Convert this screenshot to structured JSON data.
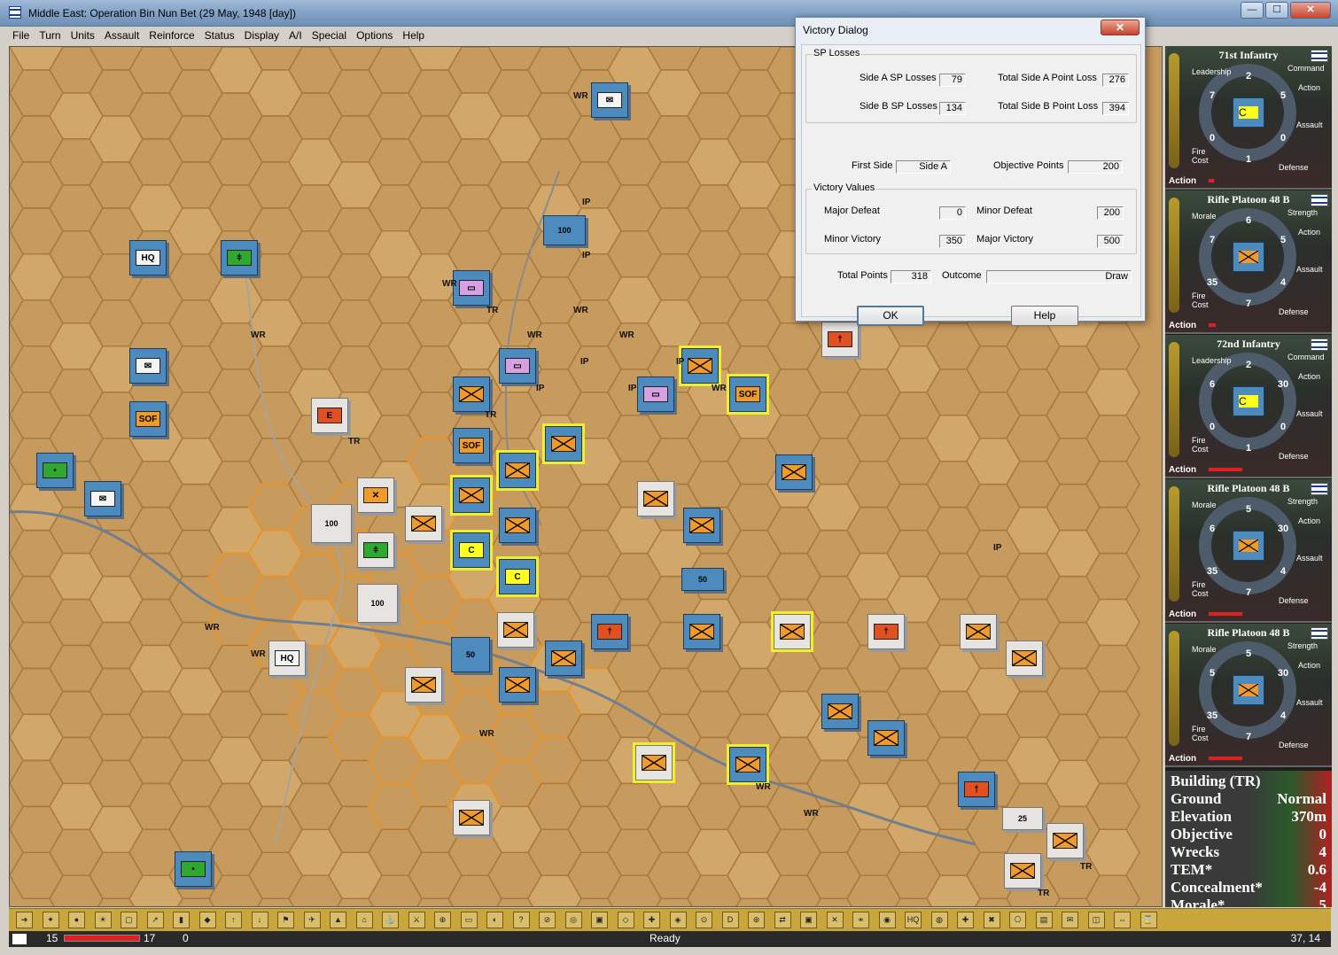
{
  "window": {
    "title": "Middle East: Operation Bin Nun Bet (29 May, 1948 [day])",
    "min": "—",
    "max": "☐",
    "close": "✕"
  },
  "menu": [
    "File",
    "Turn",
    "Units",
    "Assault",
    "Reinforce",
    "Status",
    "Display",
    "A/I",
    "Special",
    "Options",
    "Help"
  ],
  "dialog": {
    "title": "Victory Dialog",
    "close": "✕",
    "sp_losses": {
      "legend": "SP Losses",
      "side_a_label": "Side A SP Losses",
      "side_a_value": "79",
      "total_a_label": "Total Side A Point Loss",
      "total_a_value": "276",
      "side_b_label": "Side B SP Losses",
      "side_b_value": "134",
      "total_b_label": "Total Side B Point Loss",
      "total_b_value": "394"
    },
    "first_side_label": "First Side",
    "first_side_value": "Side A",
    "objective_label": "Objective Points",
    "objective_value": "200",
    "victory_values": {
      "legend": "Victory Values",
      "major_defeat_label": "Major Defeat",
      "major_defeat_value": "0",
      "minor_defeat_label": "Minor Defeat",
      "minor_defeat_value": "200",
      "minor_victory_label": "Minor Victory",
      "minor_victory_value": "350",
      "major_victory_label": "Major Victory",
      "major_victory_value": "500"
    },
    "total_points_label": "Total Points",
    "total_points_value": "318",
    "outcome_label": "Outcome",
    "outcome_value": "Draw",
    "ok": "OK",
    "help": "Help"
  },
  "units": [
    {
      "title": "71st Infantry",
      "top_left": "Leadership",
      "top_right": "Command",
      "action": "Action",
      "assault": "Assault",
      "fire_cost": "Fire\nCost",
      "defense": "Defense",
      "n_top": "2",
      "n_tl": "7",
      "n_tr": "5",
      "n_l": "0",
      "n_r": "0",
      "n_bot": "1",
      "symbol": "C",
      "symbol_color": "yellow"
    },
    {
      "title": "Rifle Platoon 48 B",
      "top_left": "Morale",
      "top_right": "Strength",
      "action": "Action",
      "assault": "Assault",
      "fire_cost": "Fire\nCost",
      "defense": "Defense",
      "n_top": "6",
      "n_tl": "7",
      "n_tr": "5",
      "n_l": "35",
      "n_r": "4",
      "n_bot": "7",
      "symbol": "",
      "symbol_color": "orange"
    },
    {
      "title": "72nd Infantry",
      "top_left": "Leadership",
      "top_right": "Command",
      "action": "Action",
      "assault": "Assault",
      "fire_cost": "Fire\nCost",
      "defense": "Defense",
      "n_top": "2",
      "n_tl": "6",
      "n_tr": "30",
      "n_l": "0",
      "n_r": "0",
      "n_bot": "1",
      "symbol": "C",
      "symbol_color": "yellow"
    },
    {
      "title": "Rifle Platoon 48 B",
      "top_left": "Morale",
      "top_right": "Strength",
      "action": "Action",
      "assault": "Assault",
      "fire_cost": "Fire\nCost",
      "defense": "Defense",
      "n_top": "5",
      "n_tl": "6",
      "n_tr": "30",
      "n_l": "35",
      "n_r": "4",
      "n_bot": "7",
      "symbol": "",
      "symbol_color": "orange"
    },
    {
      "title": "Rifle Platoon 48 B",
      "top_left": "Morale",
      "top_right": "Strength",
      "action": "Action",
      "assault": "Assault",
      "fire_cost": "Fire\nCost",
      "defense": "Defense",
      "n_top": "5",
      "n_tl": "5",
      "n_tr": "30",
      "n_l": "35",
      "n_r": "4",
      "n_bot": "7",
      "symbol": "",
      "symbol_color": "orange"
    }
  ],
  "terrain": {
    "rows": [
      {
        "label": "Building (TR)",
        "value": ""
      },
      {
        "label": "Ground",
        "value": "Normal"
      },
      {
        "label": "Elevation",
        "value": "370m"
      },
      {
        "label": "Objective",
        "value": "0"
      },
      {
        "label": "Wrecks",
        "value": "4"
      },
      {
        "label": "TEM*",
        "value": "0.6"
      },
      {
        "label": "Concealment*",
        "value": "-4"
      },
      {
        "label": "Morale*",
        "value": "5"
      }
    ]
  },
  "map_labels": {
    "wr": "WR",
    "ip": "IP",
    "tr": "TR",
    "hq": "HQ",
    "sof": "SOF",
    "n100": "100",
    "n50": "50",
    "n25": "25",
    "c": "C"
  },
  "status": {
    "left_num": "15",
    "right_num": "17",
    "zero": "0",
    "state": "Ready",
    "coord": "37, 14"
  },
  "colors": {
    "map": "#c79a5e",
    "hex_line": "#a97a3e",
    "highlight_hex": "#e8932a",
    "israel_counter": "#4d8bbf"
  }
}
